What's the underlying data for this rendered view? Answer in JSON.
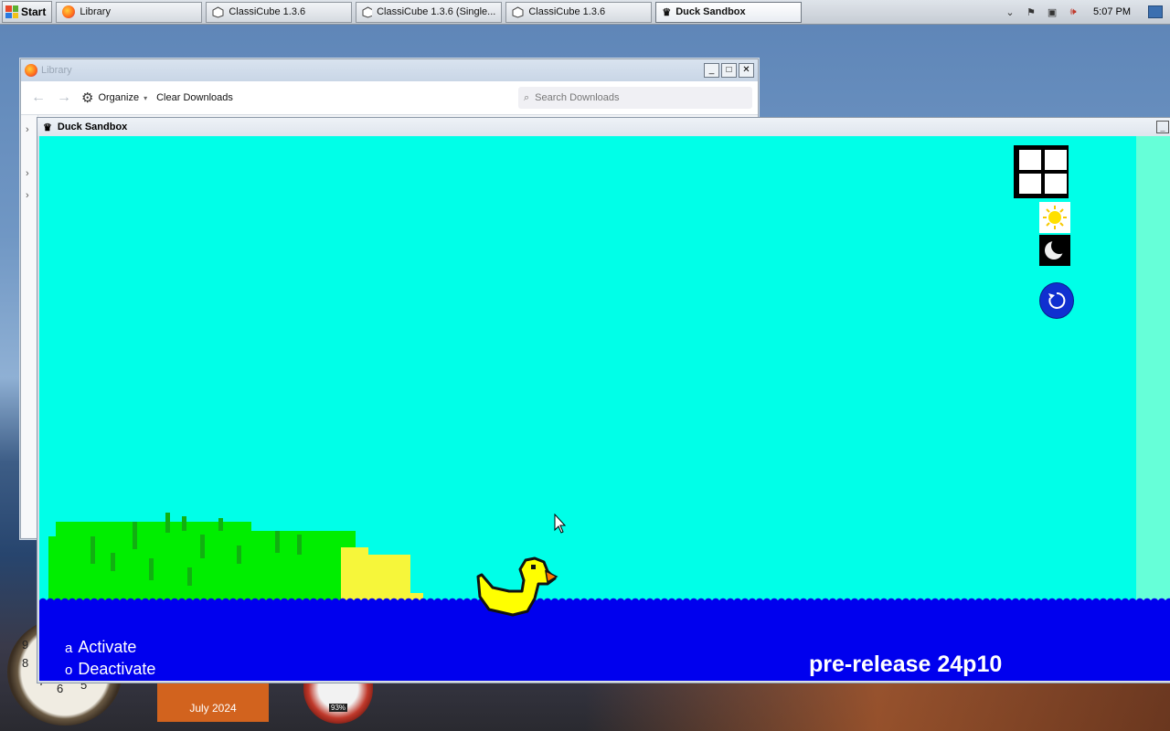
{
  "taskbar": {
    "start_label": "Start",
    "tasks": [
      {
        "label": "Library",
        "icon": "firefox-icon"
      },
      {
        "label": "ClassiCube 1.3.6",
        "icon": "classicube-icon"
      },
      {
        "label": "ClassiCube 1.3.6 (Single...",
        "icon": "classicube-icon"
      },
      {
        "label": "ClassiCube 1.3.6",
        "icon": "classicube-icon"
      },
      {
        "label": "Duck Sandbox",
        "icon": "duck-sandbox-icon",
        "active": true
      }
    ],
    "tray_icons": [
      "chevron-down-icon",
      "flag-icon",
      "network-icon",
      "volume-muted-icon"
    ],
    "clock": "5:07 PM"
  },
  "library_window": {
    "title": "Library",
    "toolbar": {
      "organize_label": "Organize",
      "clear_downloads_label": "Clear Downloads",
      "search_placeholder": "Search Downloads"
    }
  },
  "duck_window": {
    "title": "Duck Sandbox",
    "legend": [
      {
        "key": "a",
        "label": "Activate"
      },
      {
        "key": "o",
        "label": "Deactivate"
      }
    ],
    "version": "pre-release 24p10",
    "colors": {
      "sky": "#00ffe8",
      "water": "#0000ee",
      "grass": "#00ee00",
      "sand": "#f6f63a",
      "duck": "#ffff00"
    }
  },
  "desktop": {
    "calendar_label": "July 2024",
    "meter_label": "93%"
  }
}
